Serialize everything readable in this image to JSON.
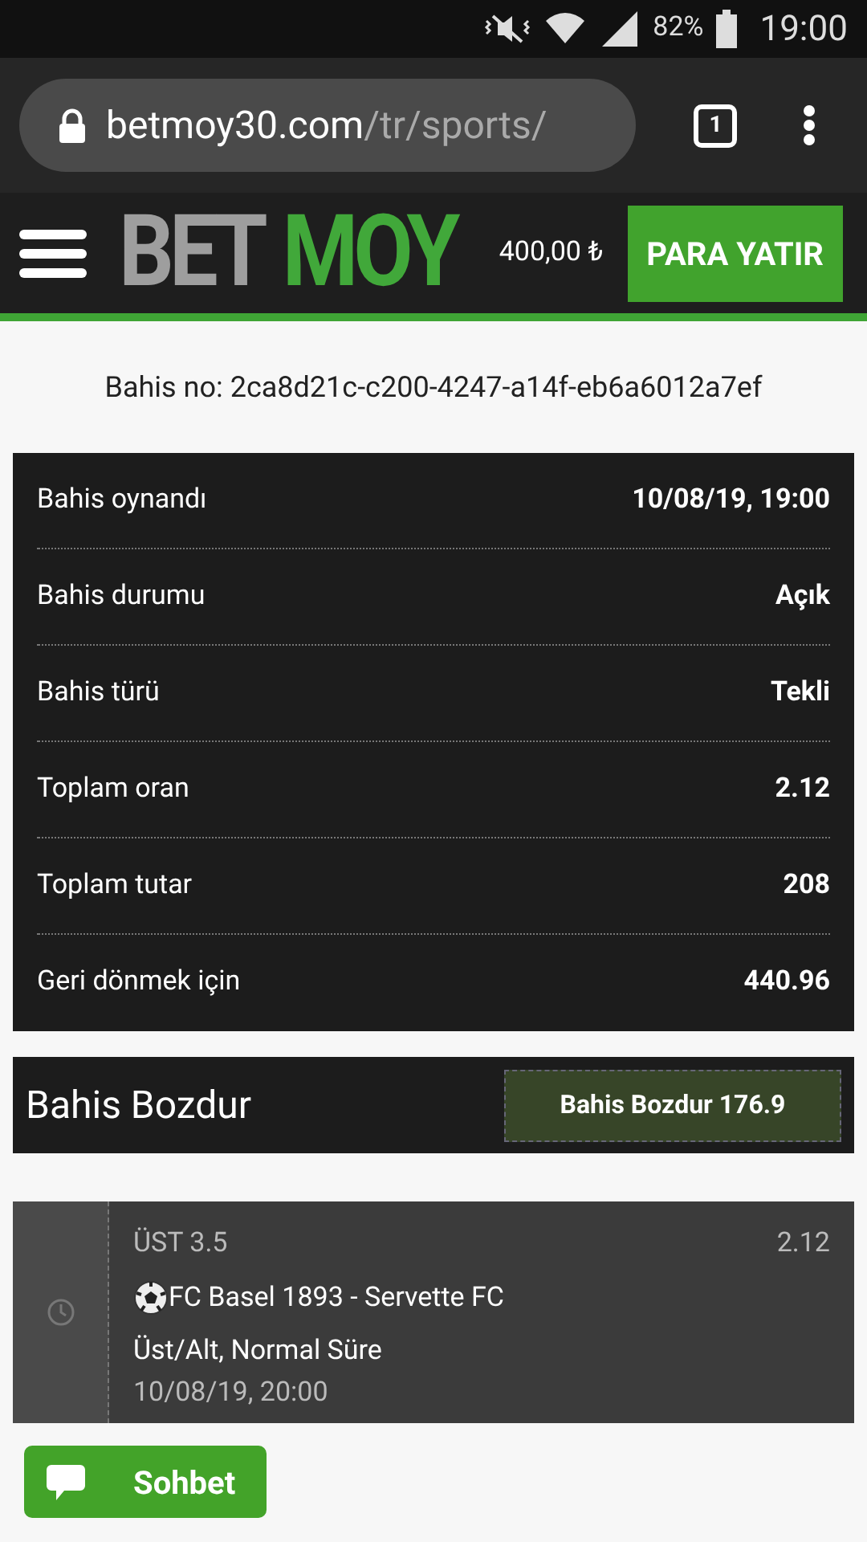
{
  "status_bar": {
    "battery": "82%",
    "time": "19:00"
  },
  "browser": {
    "url_host": "betmoy30.com",
    "url_path": "/tr/sports/",
    "tab_count": "1"
  },
  "header": {
    "logo_left": "BET",
    "logo_right": "MOY",
    "balance": "400,00 ₺",
    "deposit_button": "PARA YATIR"
  },
  "bet_id": "Bahis no: 2ca8d21c-c200-4247-a14f-eb6a6012a7ef",
  "details": [
    {
      "label": "Bahis oynandı",
      "value": "10/08/19, 19:00"
    },
    {
      "label": "Bahis durumu",
      "value": "Açık"
    },
    {
      "label": "Bahis türü",
      "value": "Tekli"
    },
    {
      "label": "Toplam oran",
      "value": "2.12"
    },
    {
      "label": "Toplam tutar",
      "value": "208"
    },
    {
      "label": "Geri dönmek için",
      "value": "440.96"
    }
  ],
  "cashout": {
    "title": "Bahis Bozdur",
    "button": "Bahis Bozdur 176.9"
  },
  "selection": {
    "market": "ÜST 3.5",
    "odds": "2.12",
    "match": "FC Basel 1893 - Servette FC",
    "bet_type": "Üst/Alt, Normal Süre",
    "date": "10/08/19, 20:00"
  },
  "chat_button": "Sohbet"
}
